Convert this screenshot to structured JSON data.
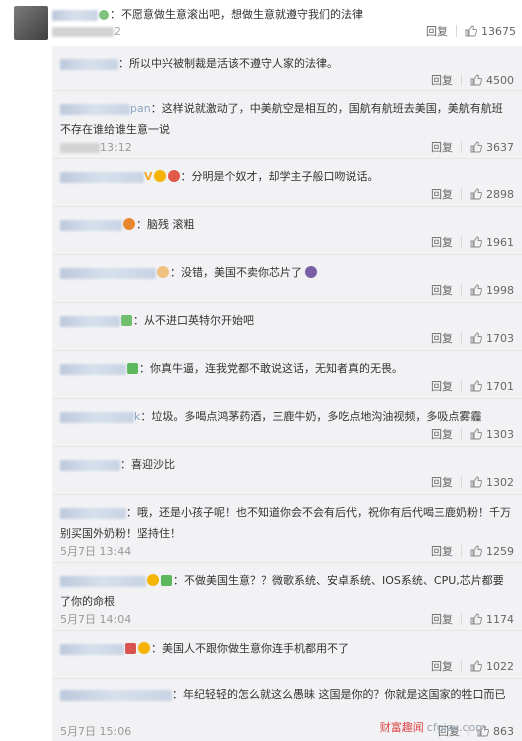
{
  "top_comment": {
    "text": "不愿意做生意滚出吧，想做生意就遵守我们的法律",
    "time_fragment": "2",
    "reply_label": "回复",
    "likes": "13675"
  },
  "replies": [
    {
      "text": "所以中兴被制裁是活该不遵守人家的法律。",
      "time": "",
      "reply_label": "回复",
      "likes": "4500",
      "badges": []
    },
    {
      "text": "这样说就激动了，中美航空是相互的，国航有航班去美国，美航有航班不存在谁给谁生意一说",
      "time": "13:12",
      "name_fragment": "pan",
      "reply_label": "回复",
      "likes": "3637",
      "badges": []
    },
    {
      "text": "分明是个奴才，却学主子般口吻说话。",
      "time": "",
      "reply_label": "回复",
      "likes": "2898",
      "badges": [
        "v-badge",
        "emoji-badge",
        "heart-badge"
      ]
    },
    {
      "text": "脑残 滚粗",
      "time": "",
      "reply_label": "回复",
      "likes": "1961",
      "badges": [
        "emoji-badge"
      ]
    },
    {
      "text": "没错，美国不卖你芯片了",
      "time": "",
      "reply_label": "回复",
      "likes": "1998",
      "badges": [
        "emoji-badge"
      ]
    },
    {
      "text": "从不进口英特尔开始吧",
      "time": "",
      "reply_label": "回复",
      "likes": "1703",
      "badges": [
        "green-badge"
      ]
    },
    {
      "text": "你真牛逼，连我党都不敢说这话，无知者真的无畏。",
      "time": "",
      "reply_label": "回复",
      "likes": "1701",
      "badges": [
        "green-badge"
      ]
    },
    {
      "text": "垃圾。多喝点鸿茅药酒，三鹿牛奶，多吃点地沟油视频，多吸点雾霾",
      "time": "",
      "name_fragment": "k",
      "reply_label": "回复",
      "likes": "1303",
      "badges": []
    },
    {
      "text": "喜迎沙比",
      "time": "",
      "reply_label": "回复",
      "likes": "1302",
      "badges": []
    },
    {
      "text": "哦，还是小孩子呢！也不知道你会不会有后代，祝你有后代喝三鹿奶粉！千万别买国外奶粉！坚持住！",
      "time": "5月7日 13:44",
      "reply_label": "回复",
      "likes": "1259",
      "badges": []
    },
    {
      "text": "不做美国生意？？微歌系统、安卓系统、IOS系统、CPU,芯片都要了你的命根",
      "time": "5月7日 14:04",
      "reply_label": "回复",
      "likes": "1174",
      "badges": [
        "emoji-badge",
        "green-badge"
      ]
    },
    {
      "text": "美国人不跟你做生意你连手机都用不了",
      "time": "",
      "reply_label": "回复",
      "likes": "1022",
      "badges": [
        "red-badge",
        "emoji-badge"
      ]
    },
    {
      "text": "年纪轻轻的怎么就这么愚昧 这国是你的？你就是这国家的牲口而已",
      "time": "5月7日 15:06",
      "reply_label": "回复",
      "likes": "863",
      "badges": []
    }
  ],
  "watermark": {
    "cn": "财富趣闻",
    "url": "cfgjzx.com"
  },
  "colors": {
    "panel_bg": "#f2f2f5",
    "link": "#eb7350",
    "text": "#333333",
    "muted": "#999999"
  }
}
